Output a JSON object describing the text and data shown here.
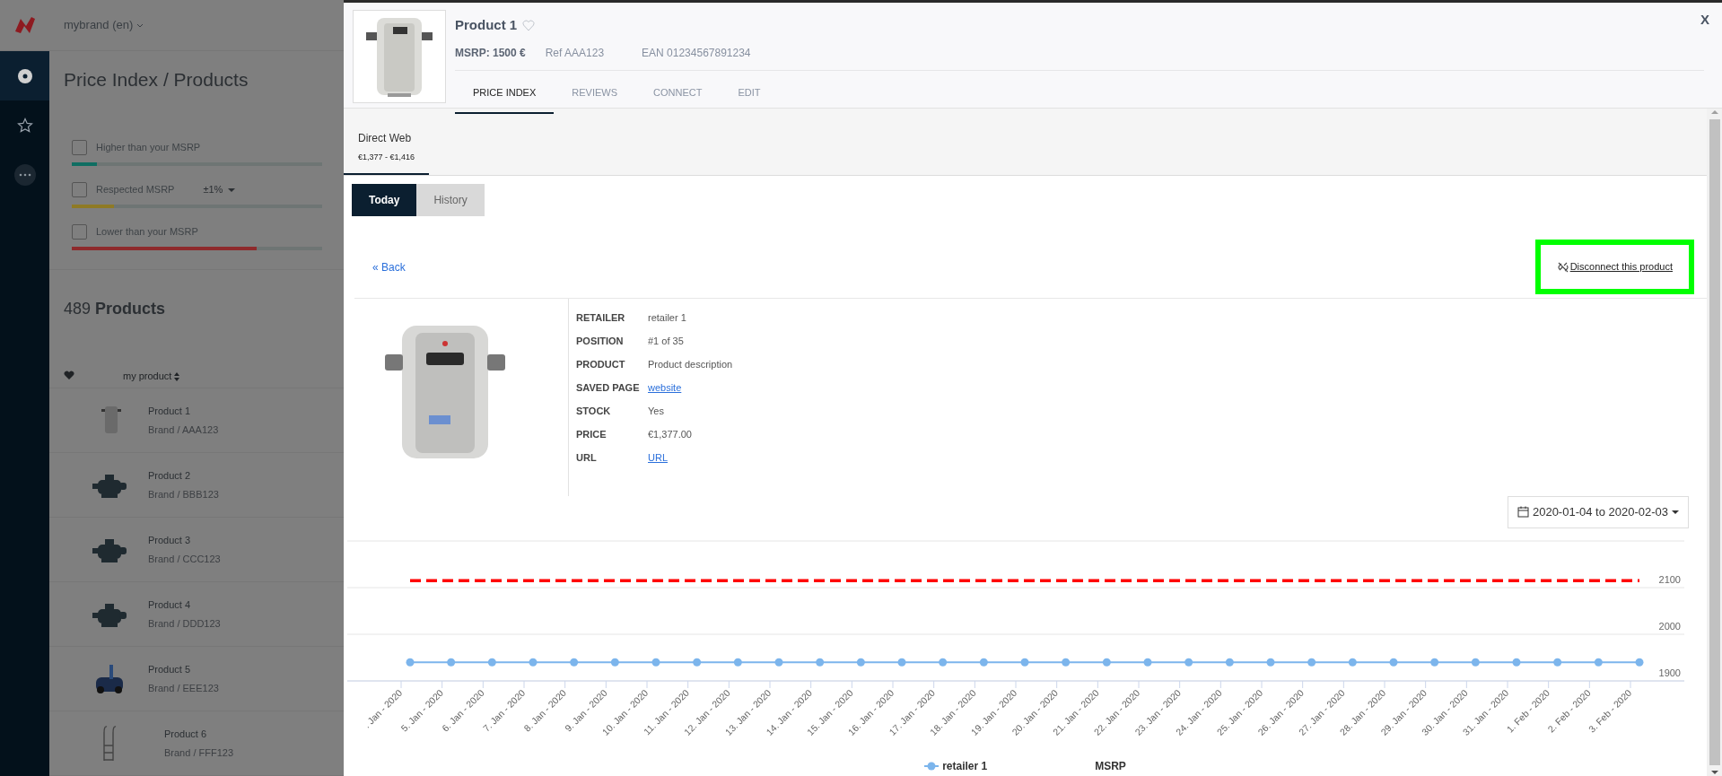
{
  "app": {
    "brand": "mybrand (en)"
  },
  "sidebar": {
    "items": [
      {
        "kind": "target",
        "selected": true
      },
      {
        "kind": "star",
        "selected": false
      },
      {
        "kind": "more",
        "selected": false
      }
    ]
  },
  "page_title": "Price Index / Products",
  "filters": [
    {
      "label": "Higher than your MSRP",
      "checked": false,
      "level": 0.1,
      "color": "#0f6e62"
    },
    {
      "label": "Respected MSRP",
      "tolerance": "±1%",
      "checked": false,
      "level": 0.17,
      "color": "#8f7a25"
    },
    {
      "label": "Lower than your MSRP",
      "checked": false,
      "level": 0.74,
      "color": "#8e2a2c"
    }
  ],
  "product_count": "489",
  "product_count_label": "Products",
  "list_header": {
    "column_1": "my product"
  },
  "products": [
    {
      "name": "Product 1",
      "sub": "Brand / AAA123",
      "kind": "heater"
    },
    {
      "name": "Product 2",
      "sub": "Brand / BBB123",
      "kind": "pump"
    },
    {
      "name": "Product 3",
      "sub": "Brand / CCC123",
      "kind": "pump"
    },
    {
      "name": "Product 4",
      "sub": "Brand / DDD123",
      "kind": "pump"
    },
    {
      "name": "Product 5",
      "sub": "Brand / EEE123",
      "kind": "robot"
    },
    {
      "name": "Product 6",
      "sub": "Brand / FFF123",
      "kind": "ladder"
    }
  ],
  "panel": {
    "title": "Product 1",
    "favorite": false,
    "msrp": "MSRP: 1500 €",
    "ref": "Ref AAA123",
    "ean": "EAN 01234567891234",
    "close": "X",
    "tabs": [
      {
        "label": "PRICE INDEX",
        "selected": true
      },
      {
        "label": "REVIEWS",
        "selected": false
      },
      {
        "label": "CONNECT",
        "selected": false
      },
      {
        "label": "EDIT",
        "selected": false
      }
    ],
    "channels": [
      {
        "name": "Direct Web",
        "range": "€1,377 - €1,416",
        "selected": true
      }
    ],
    "view_toggle": [
      {
        "label": "Today",
        "selected": true
      },
      {
        "label": "History",
        "selected": false
      }
    ],
    "back_link": "« Back",
    "disconnect": "Disconnect this product",
    "details": [
      {
        "label": "RETAILER",
        "value": "retailer 1",
        "kind": "text"
      },
      {
        "label": "POSITION",
        "value": "#1 of 35",
        "kind": "text"
      },
      {
        "label": "PRODUCT",
        "value": "Product description",
        "kind": "text"
      },
      {
        "label": "SAVED PAGE",
        "value": "website",
        "kind": "link"
      },
      {
        "label": "STOCK",
        "value": "Yes",
        "kind": "text"
      },
      {
        "label": "PRICE",
        "value": "€1,377.00",
        "kind": "text"
      },
      {
        "label": "URL",
        "value": "URL",
        "kind": "link"
      }
    ],
    "date_range": "2020-01-04 to 2020-02-03",
    "chart_data": {
      "type": "line",
      "categories": [
        ". Jan - 2020",
        "5. Jan - 2020",
        "6. Jan - 2020",
        "7. Jan - 2020",
        "8. Jan - 2020",
        "9. Jan - 2020",
        "10. Jan - 2020",
        "11. Jan - 2020",
        "12. Jan - 2020",
        "13. Jan - 2020",
        "14. Jan - 2020",
        "15. Jan - 2020",
        "16. Jan - 2020",
        "17. Jan - 2020",
        "18. Jan - 2020",
        "19. Jan - 2020",
        "20. Jan - 2020",
        "21. Jan - 2020",
        "22. Jan - 2020",
        "23. Jan - 2020",
        "24. Jan - 2020",
        "25. Jan - 2020",
        "26. Jan - 2020",
        "27. Jan - 2020",
        "28. Jan - 2020",
        "29. Jan - 2020",
        "30. Jan - 2020",
        "31. Jan - 2020",
        "1. Feb - 2020",
        "2. Feb - 2020",
        "3. Feb - 2020"
      ],
      "series": [
        {
          "name": "retailer 1",
          "color": "#7cb5ec",
          "marker": "circle",
          "values": [
            1940,
            1940,
            1940,
            1940,
            1940,
            1940,
            1940,
            1940,
            1940,
            1940,
            1940,
            1940,
            1940,
            1940,
            1940,
            1940,
            1940,
            1940,
            1940,
            1940,
            1940,
            1940,
            1940,
            1940,
            1940,
            1940,
            1940,
            1940,
            1940,
            1940,
            1940
          ]
        },
        {
          "name": "MSRP",
          "color": "#ff0000",
          "line_style": "dashed",
          "values": [
            2115,
            2115,
            2115,
            2115,
            2115,
            2115,
            2115,
            2115,
            2115,
            2115,
            2115,
            2115,
            2115,
            2115,
            2115,
            2115,
            2115,
            2115,
            2115,
            2115,
            2115,
            2115,
            2115,
            2115,
            2115,
            2115,
            2115,
            2115,
            2115,
            2115,
            2115
          ]
        }
      ],
      "ylim": [
        1900,
        2200
      ],
      "yticks": [
        1900,
        2000,
        2100
      ]
    }
  }
}
